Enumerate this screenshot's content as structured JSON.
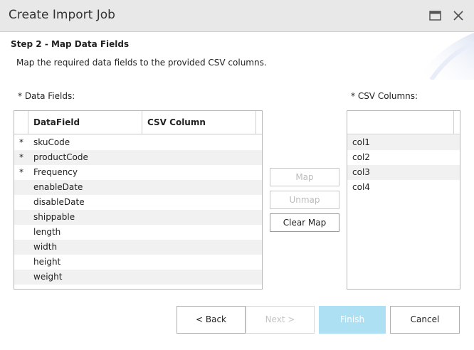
{
  "window": {
    "title": "Create Import Job",
    "maximize_icon": "maximize-icon",
    "close_icon": "close-icon"
  },
  "step": {
    "title": "Step 2 - Map Data Fields",
    "description": "Map the required data fields to the provided CSV columns."
  },
  "data_fields": {
    "label": "* Data Fields:",
    "columns": [
      "DataField",
      "CSV Column"
    ],
    "rows": [
      {
        "required": "*",
        "field": "skuCode",
        "csv": ""
      },
      {
        "required": "*",
        "field": "productCode",
        "csv": ""
      },
      {
        "required": "*",
        "field": "Frequency",
        "csv": ""
      },
      {
        "required": "",
        "field": "enableDate",
        "csv": ""
      },
      {
        "required": "",
        "field": "disableDate",
        "csv": ""
      },
      {
        "required": "",
        "field": "shippable",
        "csv": ""
      },
      {
        "required": "",
        "field": "length",
        "csv": ""
      },
      {
        "required": "",
        "field": "width",
        "csv": ""
      },
      {
        "required": "",
        "field": "height",
        "csv": ""
      },
      {
        "required": "",
        "field": "weight",
        "csv": ""
      }
    ]
  },
  "csv_columns": {
    "label": "* CSV Columns:",
    "items": [
      "col1",
      "col2",
      "col3",
      "col4"
    ]
  },
  "mapping_buttons": {
    "map": "Map",
    "unmap": "Unmap",
    "clear_map": "Clear Map"
  },
  "footer": {
    "back": "< Back",
    "next": "Next >",
    "finish": "Finish",
    "cancel": "Cancel"
  },
  "colors": {
    "titlebar_bg": "#e8e8e8",
    "row_alt_bg": "#f1f1f1",
    "finish_disabled_bg": "#aee0f3"
  }
}
